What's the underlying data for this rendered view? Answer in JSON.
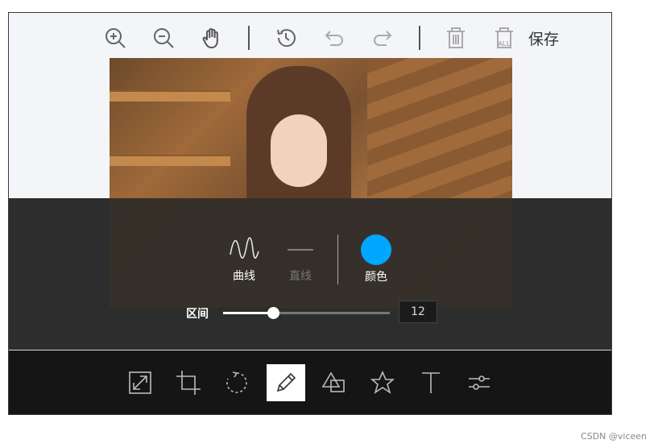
{
  "toolbar": {
    "icons": [
      "zoom-in-icon",
      "zoom-out-icon",
      "hand-icon",
      "history-icon",
      "undo-icon",
      "redo-icon",
      "delete-icon",
      "delete-all-icon"
    ],
    "delete_all_caption": "ALL",
    "save_label": "保存"
  },
  "draw_panel": {
    "curve_label": "曲线",
    "line_label": "直线",
    "color_label": "颜色",
    "color_value": "#00a6ff",
    "range_label": "区间",
    "range_value": "12",
    "range_fraction": 0.3
  },
  "bottom_tools": [
    "resize-icon",
    "crop-icon",
    "rotate-icon",
    "draw-icon",
    "shape-icon",
    "icon-star-icon",
    "text-icon",
    "filter-icon"
  ],
  "watermark": "CSDN @viceen"
}
